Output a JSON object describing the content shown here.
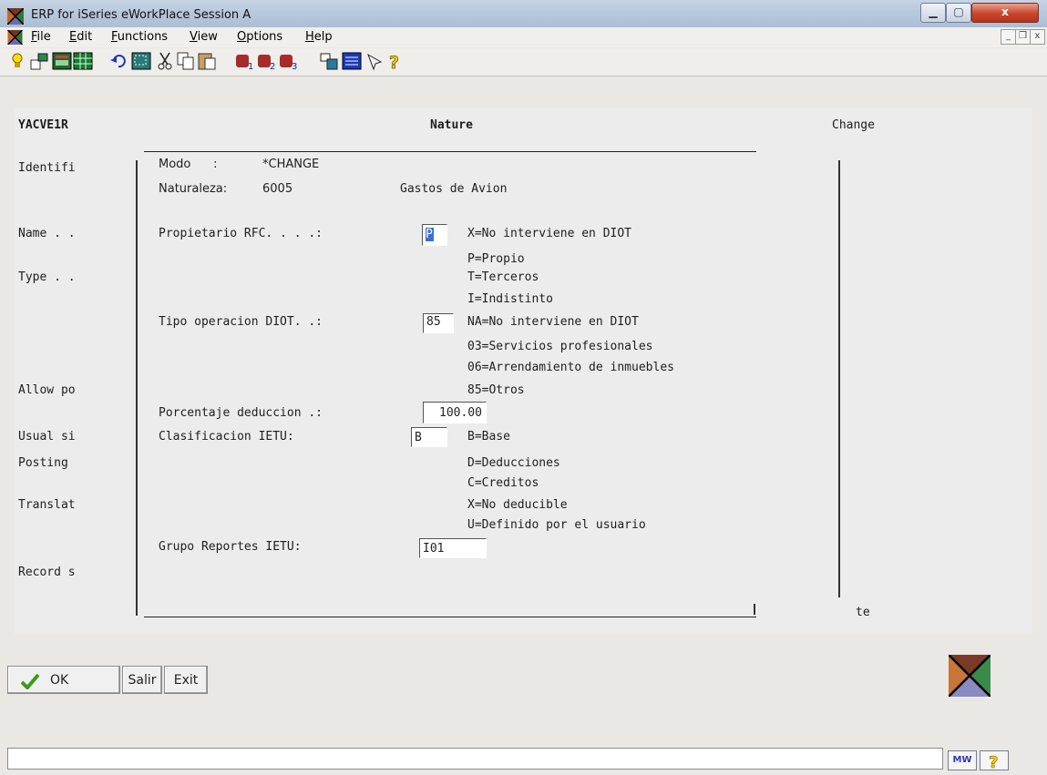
{
  "window": {
    "title": "ERP for iSeries eWorkPlace Session A",
    "close_label": "x"
  },
  "menu": [
    {
      "label": "File",
      "u": "F",
      "rest": "ile"
    },
    {
      "label": "Edit",
      "u": "E",
      "rest": "dit"
    },
    {
      "label": "Functions",
      "u": "F",
      "rest": "unctions"
    },
    {
      "label": "View",
      "u": "V",
      "rest": "iew"
    },
    {
      "label": "Options",
      "u": "O",
      "rest": "ptions"
    },
    {
      "label": "Help",
      "u": "H",
      "rest": "elp"
    }
  ],
  "toolbar_icons": [
    "lightbulb-icon",
    "connect-icon",
    "screen-icon",
    "spreadsheet-icon",
    "undo-icon",
    "select-icon",
    "cut-icon",
    "copy-icon",
    "paste-icon",
    "macro1-icon",
    "macro2-icon",
    "macro3-icon",
    "hotspot-icon",
    "keypad-icon",
    "settings-icon",
    "help-icon"
  ],
  "screen": {
    "program": "YACVE1R",
    "heading": "Nature",
    "mode_right": "Change",
    "left_labels": [
      "Identifi",
      "Name . .",
      "Type . .",
      "Allow po",
      "Usual si",
      "Posting",
      "Translat",
      "Record s"
    ],
    "right_fragment": "te",
    "popup": {
      "modo_label": "Modo      :",
      "modo_value": "*CHANGE",
      "naturaleza_label": "Naturaleza:",
      "naturaleza_code": "6005",
      "naturaleza_desc": "Gastos de Avion",
      "propietario_label": "Propietario RFC. . . .:",
      "propietario_value": "P",
      "propietario_options": [
        "X=No interviene en DIOT",
        "P=Propio",
        "T=Terceros",
        "I=Indistinto"
      ],
      "tipo_label": "Tipo operacion DIOT. .:",
      "tipo_value": "85",
      "tipo_options": [
        "NA=No interviene en DIOT",
        "03=Servicios profesionales",
        "06=Arrendamiento de inmuebles",
        "85=Otros"
      ],
      "porcentaje_label": "Porcentaje deduccion .:",
      "porcentaje_value": "100.00",
      "clasificacion_label": "Clasificacion IETU:",
      "clasificacion_value": "B",
      "clasificacion_options": [
        "B=Base",
        "D=Deducciones",
        "C=Creditos",
        "X=No deducible",
        "U=Definido por el usuario"
      ],
      "grupo_label": "Grupo Reportes IETU:",
      "grupo_value": "I01"
    }
  },
  "buttons": {
    "ok": "OK",
    "salir": "Salir",
    "exit": "Exit"
  },
  "status": {
    "mw": "MW"
  }
}
